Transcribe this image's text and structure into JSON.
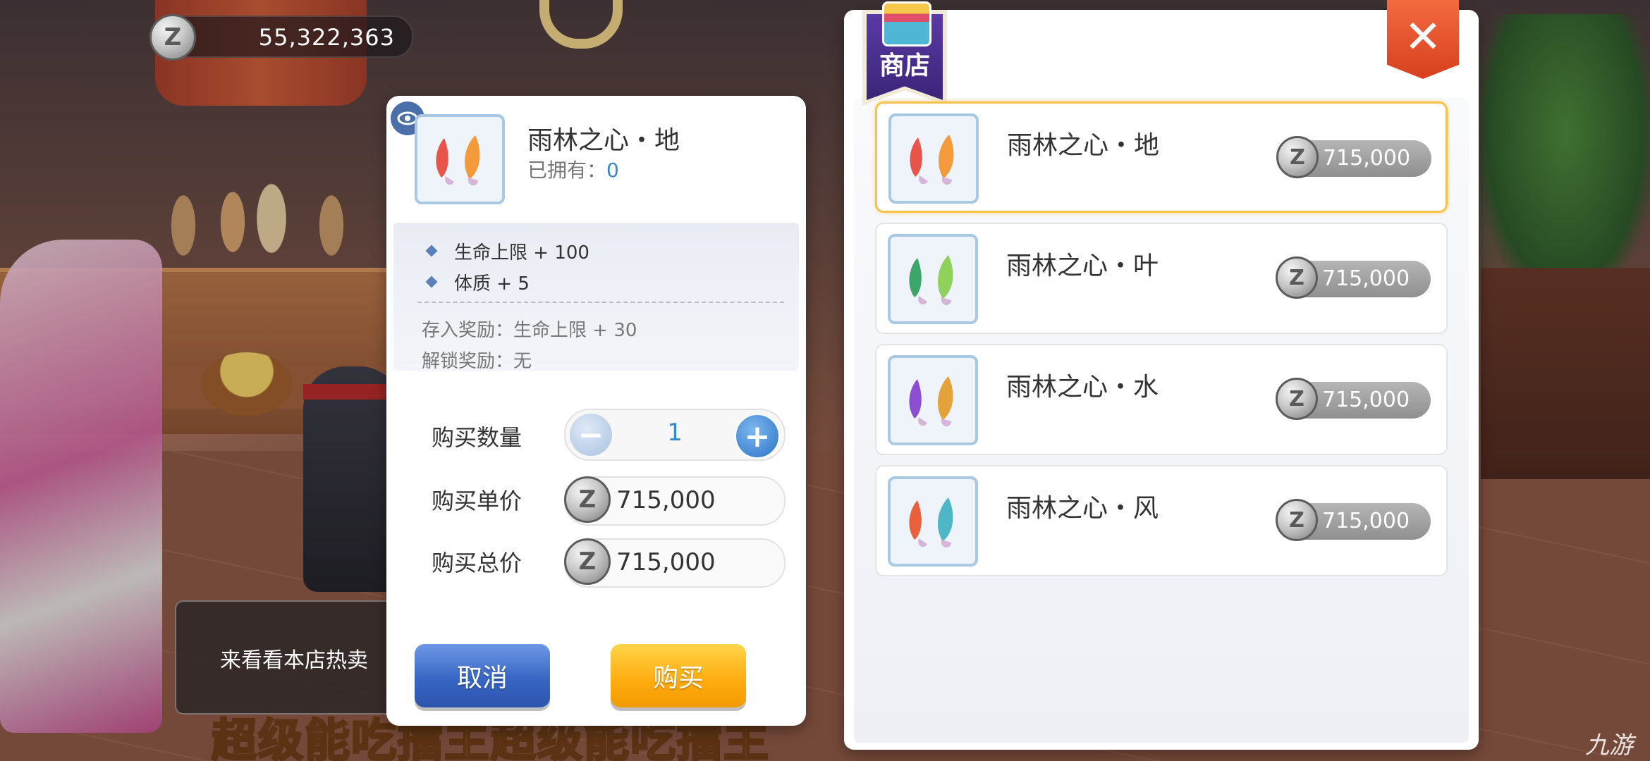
{
  "currency": {
    "amount": "55,322,363",
    "icon": "zeny-coin-icon",
    "symbol": "Z"
  },
  "chat": {
    "text": "来看看本店热卖"
  },
  "banner_text": "超级能吃擂主超级能吃擂主",
  "dialog": {
    "item_name": "雨林之心・地",
    "owned_label": "已拥有：",
    "owned_value": "0",
    "attributes": [
      "生命上限 + 100",
      "体质 + 5"
    ],
    "store_reward": "存入奖励：生命上限 + 30",
    "unlock_reward": "解锁奖励：无",
    "qty_label": "购买数量",
    "qty_value": "1",
    "minus": "−",
    "plus": "+",
    "unit_price_label": "购买单价",
    "unit_price": "715,000",
    "total_price_label": "购买总价",
    "total_price": "715,000",
    "cancel_label": "取消",
    "buy_label": "购买"
  },
  "shop": {
    "title": "商店",
    "close": "✕",
    "items": [
      {
        "name": "雨林之心・地",
        "price": "715,000",
        "colors": [
          "#e8534a",
          "#f29a3c"
        ]
      },
      {
        "name": "雨林之心・叶",
        "price": "715,000",
        "colors": [
          "#3ca66a",
          "#8fd15b"
        ]
      },
      {
        "name": "雨林之心・水",
        "price": "715,000",
        "colors": [
          "#8a4fd1",
          "#e3a23a"
        ]
      },
      {
        "name": "雨林之心・风",
        "price": "715,000",
        "colors": [
          "#e8603c",
          "#4fb6c8"
        ]
      }
    ]
  },
  "watermark": "九游"
}
